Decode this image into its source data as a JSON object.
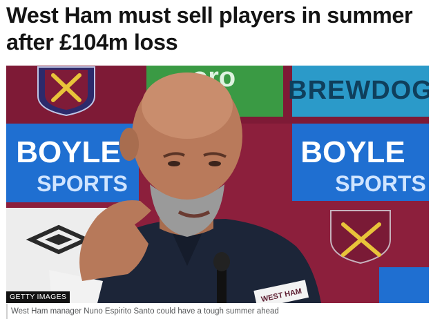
{
  "article": {
    "headline": "West Ham must sell players in summer after £104m loss"
  },
  "image": {
    "credit": "GETTY IMAGES",
    "caption": "West Ham manager Nuno Espirito Santo could have a tough summer ahead",
    "backdrop_text": {
      "sponsor_1_line1": "BOYLE",
      "sponsor_1_line2": "SPORTS",
      "sponsor_2_line1": "BOYLE",
      "sponsor_2_line2": "SPORTS",
      "brewery": "BREWDOG",
      "green_board": "oro",
      "tag": "WEST HAM"
    }
  },
  "colors": {
    "claret": "#8f1f3d",
    "sponsor_blue": "#1f6fd1",
    "brewdog_blue": "#2b9ac9",
    "green": "#3a9a44",
    "gold": "#e8c43a"
  }
}
